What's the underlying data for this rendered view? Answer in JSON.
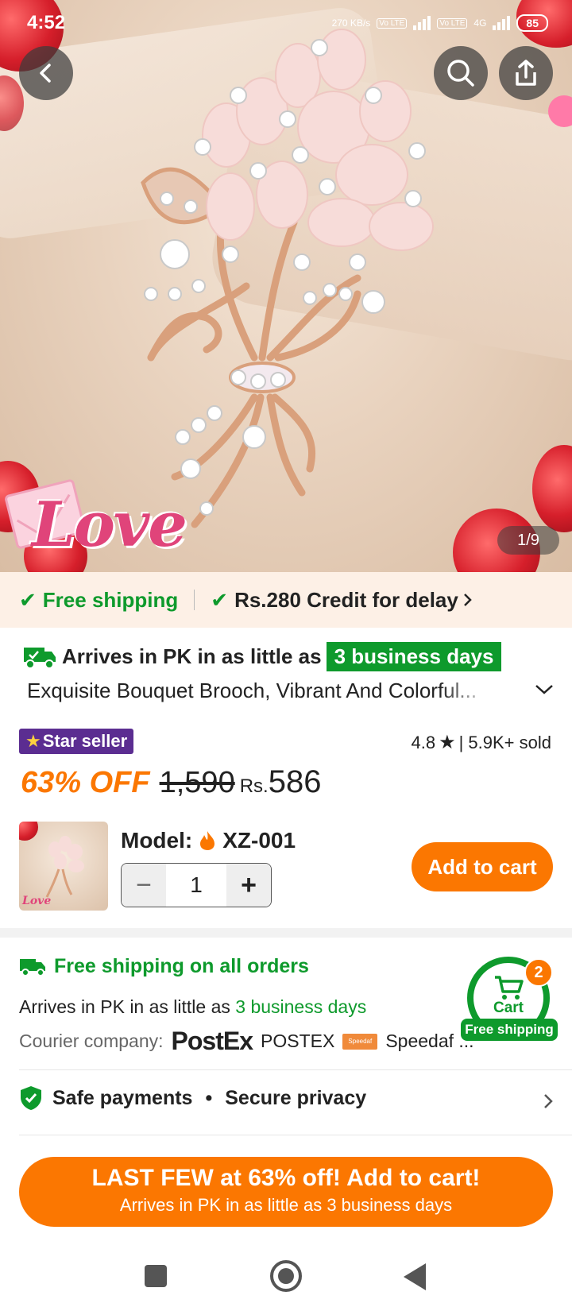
{
  "status_bar": {
    "time": "4:52",
    "net_speed": "270 KB/s",
    "sim1": "Vo LTE",
    "sim2": "Vo LTE",
    "net": "4G",
    "battery": "85"
  },
  "hero": {
    "counter": "1/9",
    "overlay_text": "Love"
  },
  "shipping_strip": {
    "free_shipping": "Free shipping",
    "credit": "Rs.280 Credit for delay"
  },
  "arrives": {
    "prefix": "Arrives in PK in as little as",
    "days": "3 business days"
  },
  "product": {
    "title": "Exquisite Bouquet Brooch, Vibrant And Colorful...",
    "star_seller": "Star seller",
    "rating": "4.8",
    "sold": "| 5.9K+ sold",
    "discount": "63% OFF",
    "old_price": "1,590",
    "currency": "Rs.",
    "price": "586",
    "model_label": "Model:",
    "model_value": "XZ-001",
    "quantity": "1",
    "add_to_cart": "Add to cart",
    "thumb_text": "Love"
  },
  "shipping_info": {
    "title": "Free shipping on all orders",
    "arrives_prefix": "Arrives in PK in as little as",
    "arrives_days": "3 business days",
    "courier_label": "Courier company:",
    "courier_logo": "PostEx",
    "courier1": "POSTEX",
    "speedaf_logo": "Speedaf",
    "courier2": "Speedaf ..."
  },
  "cart_float": {
    "label": "Cart",
    "badge": "2",
    "ship": "Free shipping"
  },
  "safe": {
    "payments": "Safe payments",
    "privacy": "Secure privacy"
  },
  "cta": {
    "line1": "LAST FEW at 63% off! Add to cart!",
    "line2": "Arrives in PK in as little as 3 business days"
  },
  "colors": {
    "accent": "#fb7701",
    "green": "#0e9a2c",
    "star_seller_bg": "#5b2d91"
  },
  "icons": [
    "back-icon",
    "search-icon",
    "share-icon",
    "check-icon",
    "chevron-right-icon",
    "truck-icon",
    "chevron-down-icon",
    "star-icon",
    "fire-icon",
    "minus-icon",
    "plus-icon",
    "shield-icon",
    "cart-icon"
  ]
}
